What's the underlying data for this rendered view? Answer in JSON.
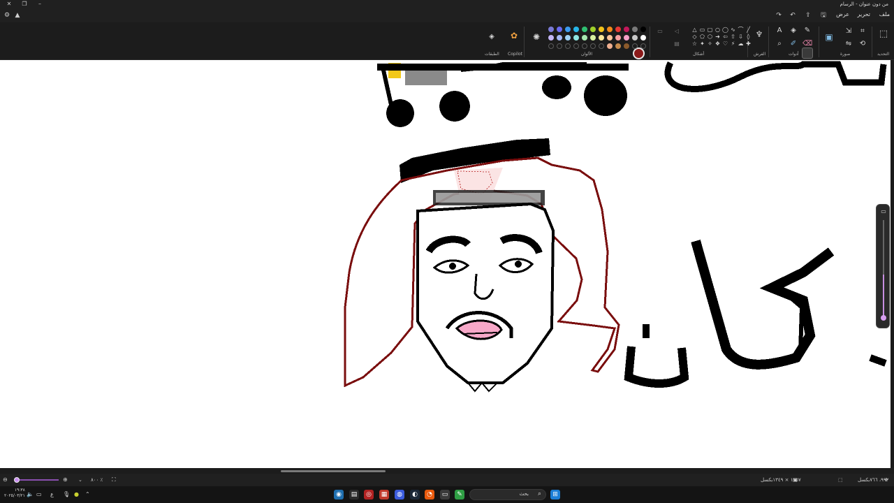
{
  "titlebar": {
    "title": "من دون عنوان - الرسام",
    "close_icon": "close-icon",
    "settings_icon": "settings-icon",
    "minimize_icon": "minimize-icon"
  },
  "menu": {
    "file": "ملف",
    "edit": "تحرير",
    "view": "عرض"
  },
  "ribbon": {
    "groups": {
      "selection": "التحديد",
      "image": "صورة",
      "tools": "أدوات",
      "brushes": "الفرش",
      "shapes": "أشكال",
      "colors": "الألوان",
      "copilot": "Copilot",
      "layers": "الطبقات"
    },
    "colors": {
      "primary": "#8b1a1a",
      "secondary": "#ffffff",
      "row1": [
        "#7a7ad6",
        "#6a6af0",
        "#3b9bf0",
        "#27b6e8",
        "#2fbf71",
        "#9fd02a",
        "#f2c21a",
        "#f28a1a",
        "#e53935",
        "#c2185b",
        "#7a7a7a",
        "#000000"
      ],
      "row2": [
        "#c3b5f5",
        "#a5b8f5",
        "#9fd2f5",
        "#8fe6e0",
        "#a8e8b0",
        "#d8f0a0",
        "#fbe79a",
        "#fcc49a",
        "#f8a0a0",
        "#f5a0c8",
        "#c8c8c8",
        "#ffffff"
      ],
      "row3": [
        "",
        "",
        "",
        "",
        "",
        "",
        "",
        "#f0b090",
        "#c68a4c",
        "#8b5a2b",
        "",
        ""
      ]
    },
    "shape_glyphs": [
      "△",
      "▭",
      "▢",
      "○",
      "◯",
      "∿",
      "⌒",
      "╱",
      "◇",
      "⬠",
      "⬡",
      "➜",
      "⇦",
      "⇧",
      "⇩",
      "◊",
      "☆",
      "✦",
      "✧",
      "❖",
      "♡",
      "⚡",
      "☁",
      "✚"
    ]
  },
  "canvas": {
    "arabic_word": "كان"
  },
  "status": {
    "position": "٩٩٢، ٧٦٦بكسل",
    "image_size": "١٢٥٧ × ١٣٤٩بكسل",
    "zoom": "٨٠٠ ٪"
  },
  "taskbar": {
    "search_placeholder": "بحث",
    "clock_time": "١٩:٣٨",
    "clock_date": "٢٠٢٥/٠٣/٢١",
    "language": "ع"
  }
}
